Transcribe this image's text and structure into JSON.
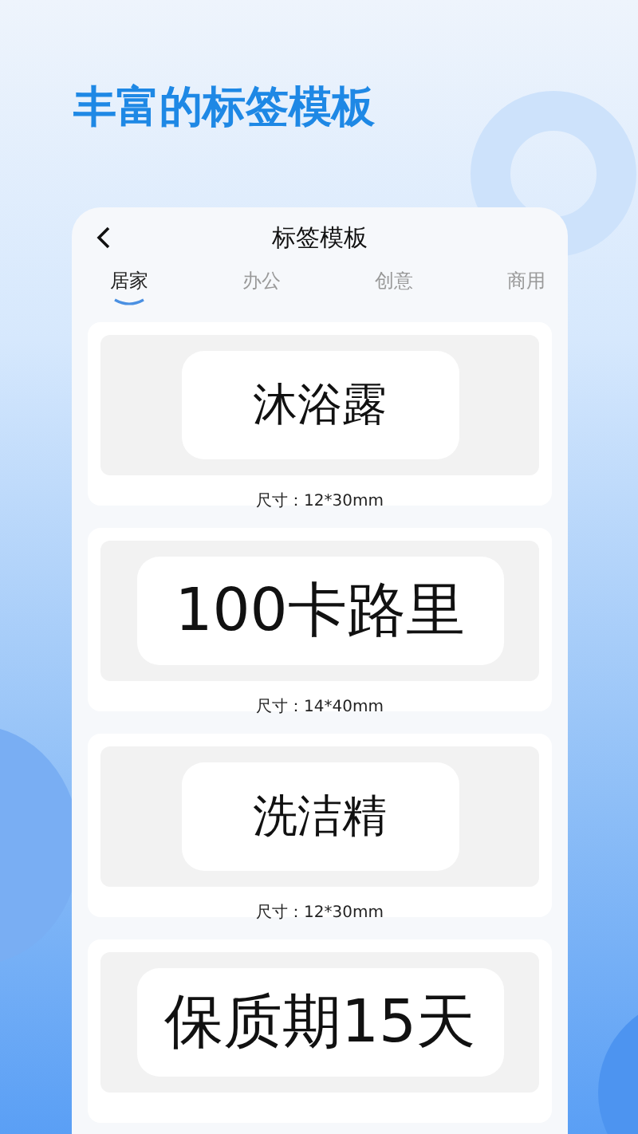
{
  "headline": "丰富的标签模板",
  "screen": {
    "title": "标签模板",
    "tabs": [
      {
        "label": "居家",
        "selected": true
      },
      {
        "label": "办公",
        "selected": false
      },
      {
        "label": "创意",
        "selected": false
      },
      {
        "label": "商用",
        "selected": false
      }
    ],
    "templates": [
      {
        "kind": "small",
        "text": "沐浴露",
        "size": "尺寸：12*30mm"
      },
      {
        "kind": "large",
        "text": "100卡路里",
        "size": "尺寸：14*40mm"
      },
      {
        "kind": "small",
        "text": "洗洁精",
        "size": "尺寸：12*30mm"
      },
      {
        "kind": "large",
        "text": "保质期15天"
      }
    ]
  }
}
